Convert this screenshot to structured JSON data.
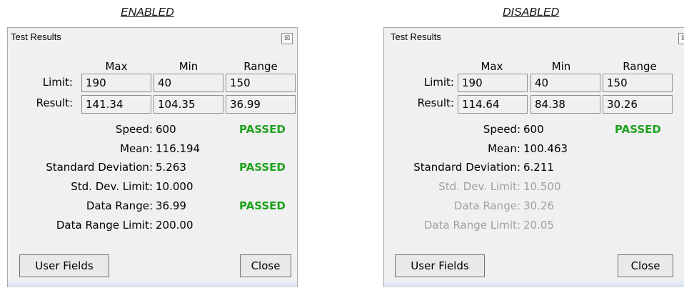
{
  "captions": {
    "enabled": "ENABLED",
    "disabled": "DISABLED"
  },
  "colors": {
    "passed": "#1ca21c",
    "disabled_text": "#a0a0a0"
  },
  "icons": {
    "close": "close-icon"
  },
  "enabled": {
    "title": "Test Results",
    "headers": {
      "max": "Max",
      "min": "Min",
      "range": "Range"
    },
    "limit_label": "Limit:",
    "result_label": "Result:",
    "limit": {
      "max": "190",
      "min": "40",
      "range": "150"
    },
    "result": {
      "max": "141.34",
      "min": "104.35",
      "range": "36.99"
    },
    "stats": {
      "speed_label": "Speed:",
      "speed": "600",
      "speed_status": "PASSED",
      "mean_label": "Mean:",
      "mean": "116.194",
      "stddev_label": "Standard Deviation:",
      "stddev": "5.263",
      "stddev_status": "PASSED",
      "stddev_limit_label": "Std. Dev. Limit:",
      "stddev_limit": "10.000",
      "data_range_label": "Data Range:",
      "data_range": "36.99",
      "data_range_status": "PASSED",
      "data_range_limit_label": "Data Range Limit:",
      "data_range_limit": "200.00"
    },
    "buttons": {
      "user_fields": "User Fields",
      "close": "Close"
    }
  },
  "disabled": {
    "title": "Test Results",
    "headers": {
      "max": "Max",
      "min": "Min",
      "range": "Range"
    },
    "limit_label": "Limit:",
    "result_label": "Result:",
    "limit": {
      "max": "190",
      "min": "40",
      "range": "150"
    },
    "result": {
      "max": "114.64",
      "min": "84.38",
      "range": "30.26"
    },
    "stats": {
      "speed_label": "Speed:",
      "speed": "600",
      "speed_status": "PASSED",
      "mean_label": "Mean:",
      "mean": "100.463",
      "stddev_label": "Standard Deviation:",
      "stddev": "6.211",
      "stddev_limit_label": "Std. Dev. Limit:",
      "stddev_limit": "10.500",
      "data_range_label": "Data Range:",
      "data_range": "30.26",
      "data_range_limit_label": "Data Range Limit:",
      "data_range_limit": "20.05"
    },
    "buttons": {
      "user_fields": "User Fields",
      "close": "Close"
    }
  }
}
